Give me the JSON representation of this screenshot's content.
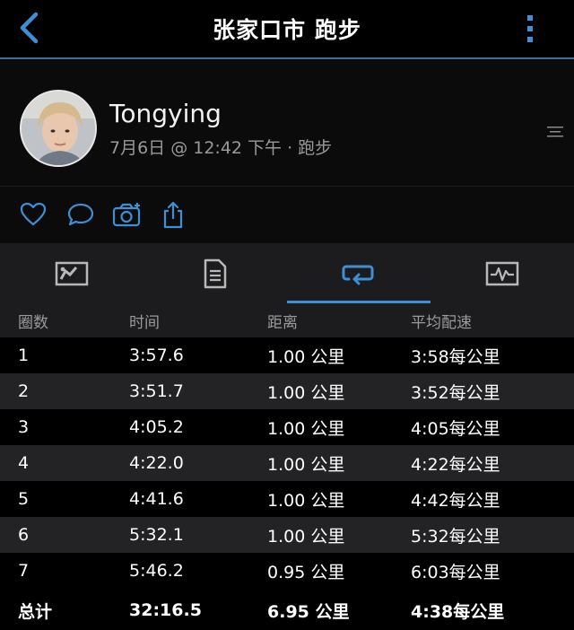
{
  "header": {
    "title": "张家口市 跑步",
    "back_icon": "chevron-left-icon",
    "more_icon": "vertical-dots-icon"
  },
  "profile": {
    "name": "Tongying",
    "subline": "7月6日 @ 12:42 下午 · 跑步"
  },
  "actions": [
    "heart-icon",
    "comment-icon",
    "camera-add-icon",
    "share-icon"
  ],
  "tabs": [
    {
      "icon": "map-icon",
      "active": false
    },
    {
      "icon": "document-list-icon",
      "active": false
    },
    {
      "icon": "laps-loop-icon",
      "active": true
    },
    {
      "icon": "chart-pulse-icon",
      "active": false
    }
  ],
  "colors": {
    "accent": "#3f8fd4",
    "header_rule": "#3f6f95",
    "subtext": "#9a9a9a"
  },
  "table": {
    "columns": [
      "圈数",
      "时间",
      "距离",
      "平均配速"
    ],
    "rows": [
      [
        "1",
        "3:57.6",
        "1.00 公里",
        "3:58每公里"
      ],
      [
        "2",
        "3:51.7",
        "1.00 公里",
        "3:52每公里"
      ],
      [
        "3",
        "4:05.2",
        "1.00 公里",
        "4:05每公里"
      ],
      [
        "4",
        "4:22.0",
        "1.00 公里",
        "4:22每公里"
      ],
      [
        "5",
        "4:41.6",
        "1.00 公里",
        "4:42每公里"
      ],
      [
        "6",
        "5:32.1",
        "1.00 公里",
        "5:32每公里"
      ],
      [
        "7",
        "5:46.2",
        "0.95 公里",
        "6:03每公里"
      ]
    ],
    "total": [
      "总计",
      "32:16.5",
      "6.95 公里",
      "4:38每公里"
    ]
  }
}
